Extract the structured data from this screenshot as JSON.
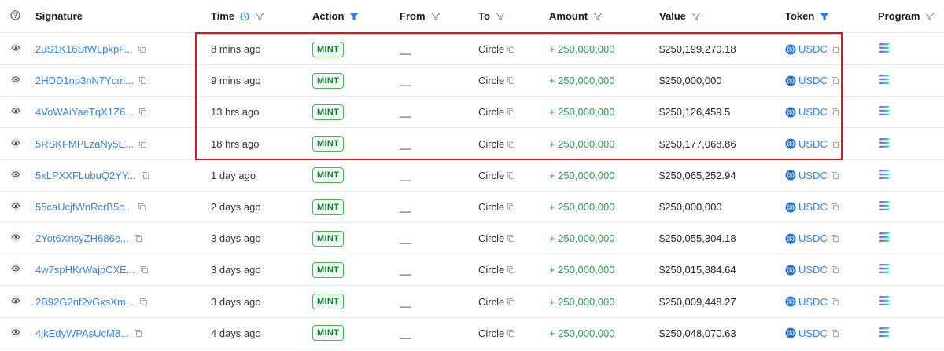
{
  "header": {
    "signature": "Signature",
    "time": "Time",
    "action": "Action",
    "from": "From",
    "to": "To",
    "amount": "Amount",
    "value": "Value",
    "token": "Token",
    "program": "Program"
  },
  "icons": {
    "help": "question-circle-icon",
    "view": "eye-icon",
    "filter": "filter-funnel-icon",
    "clock": "clock-icon",
    "copy": "copy-icon",
    "token": "usdc-coin-icon",
    "program": "solana-logo-icon"
  },
  "colors": {
    "link": "#3b82d4",
    "amount": "#2f9a4f",
    "badge_border": "#4caf62",
    "filter_active": "#2f7fd6",
    "highlight": "#e3111b"
  },
  "rows": [
    {
      "signature": "2uS1K16StWLpkpF...",
      "time": "8 mins ago",
      "action": "MINT",
      "from": "__",
      "to": "Circle",
      "amount": "+ 250,000,000",
      "value": "$250,199,270.18",
      "token": "USDC"
    },
    {
      "signature": "2HDD1np3nN7Ycm...",
      "time": "9 mins ago",
      "action": "MINT",
      "from": "__",
      "to": "Circle",
      "amount": "+ 250,000,000",
      "value": "$250,000,000",
      "token": "USDC"
    },
    {
      "signature": "4VoWAiYaeTqX1Z6...",
      "time": "13 hrs ago",
      "action": "MINT",
      "from": "__",
      "to": "Circle",
      "amount": "+ 250,000,000",
      "value": "$250,126,459.5",
      "token": "USDC"
    },
    {
      "signature": "5RSKFMPLzaNy5E...",
      "time": "18 hrs ago",
      "action": "MINT",
      "from": "__",
      "to": "Circle",
      "amount": "+ 250,000,000",
      "value": "$250,177,068.86",
      "token": "USDC"
    },
    {
      "signature": "5xLPXXFLubuQ2YY...",
      "time": "1 day ago",
      "action": "MINT",
      "from": "__",
      "to": "Circle",
      "amount": "+ 250,000,000",
      "value": "$250,065,252.94",
      "token": "USDC"
    },
    {
      "signature": "55caUcjfWnRcrB5c...",
      "time": "2 days ago",
      "action": "MINT",
      "from": "__",
      "to": "Circle",
      "amount": "+ 250,000,000",
      "value": "$250,000,000",
      "token": "USDC"
    },
    {
      "signature": "2Yot6XnsyZH686e...",
      "time": "3 days ago",
      "action": "MINT",
      "from": "__",
      "to": "Circle",
      "amount": "+ 250,000,000",
      "value": "$250,055,304.18",
      "token": "USDC"
    },
    {
      "signature": "4w7spHKrWajpCXE...",
      "time": "3 days ago",
      "action": "MINT",
      "from": "__",
      "to": "Circle",
      "amount": "+ 250,000,000",
      "value": "$250,015,884.64",
      "token": "USDC"
    },
    {
      "signature": "2B92G2nf2vGxsXm...",
      "time": "3 days ago",
      "action": "MINT",
      "from": "__",
      "to": "Circle",
      "amount": "+ 250,000,000",
      "value": "$250,009,448.27",
      "token": "USDC"
    },
    {
      "signature": "4jkEdyWPAsUcM8...",
      "time": "4 days ago",
      "action": "MINT",
      "from": "__",
      "to": "Circle",
      "amount": "+ 250,000,000",
      "value": "$250,048,070.63",
      "token": "USDC"
    }
  ]
}
